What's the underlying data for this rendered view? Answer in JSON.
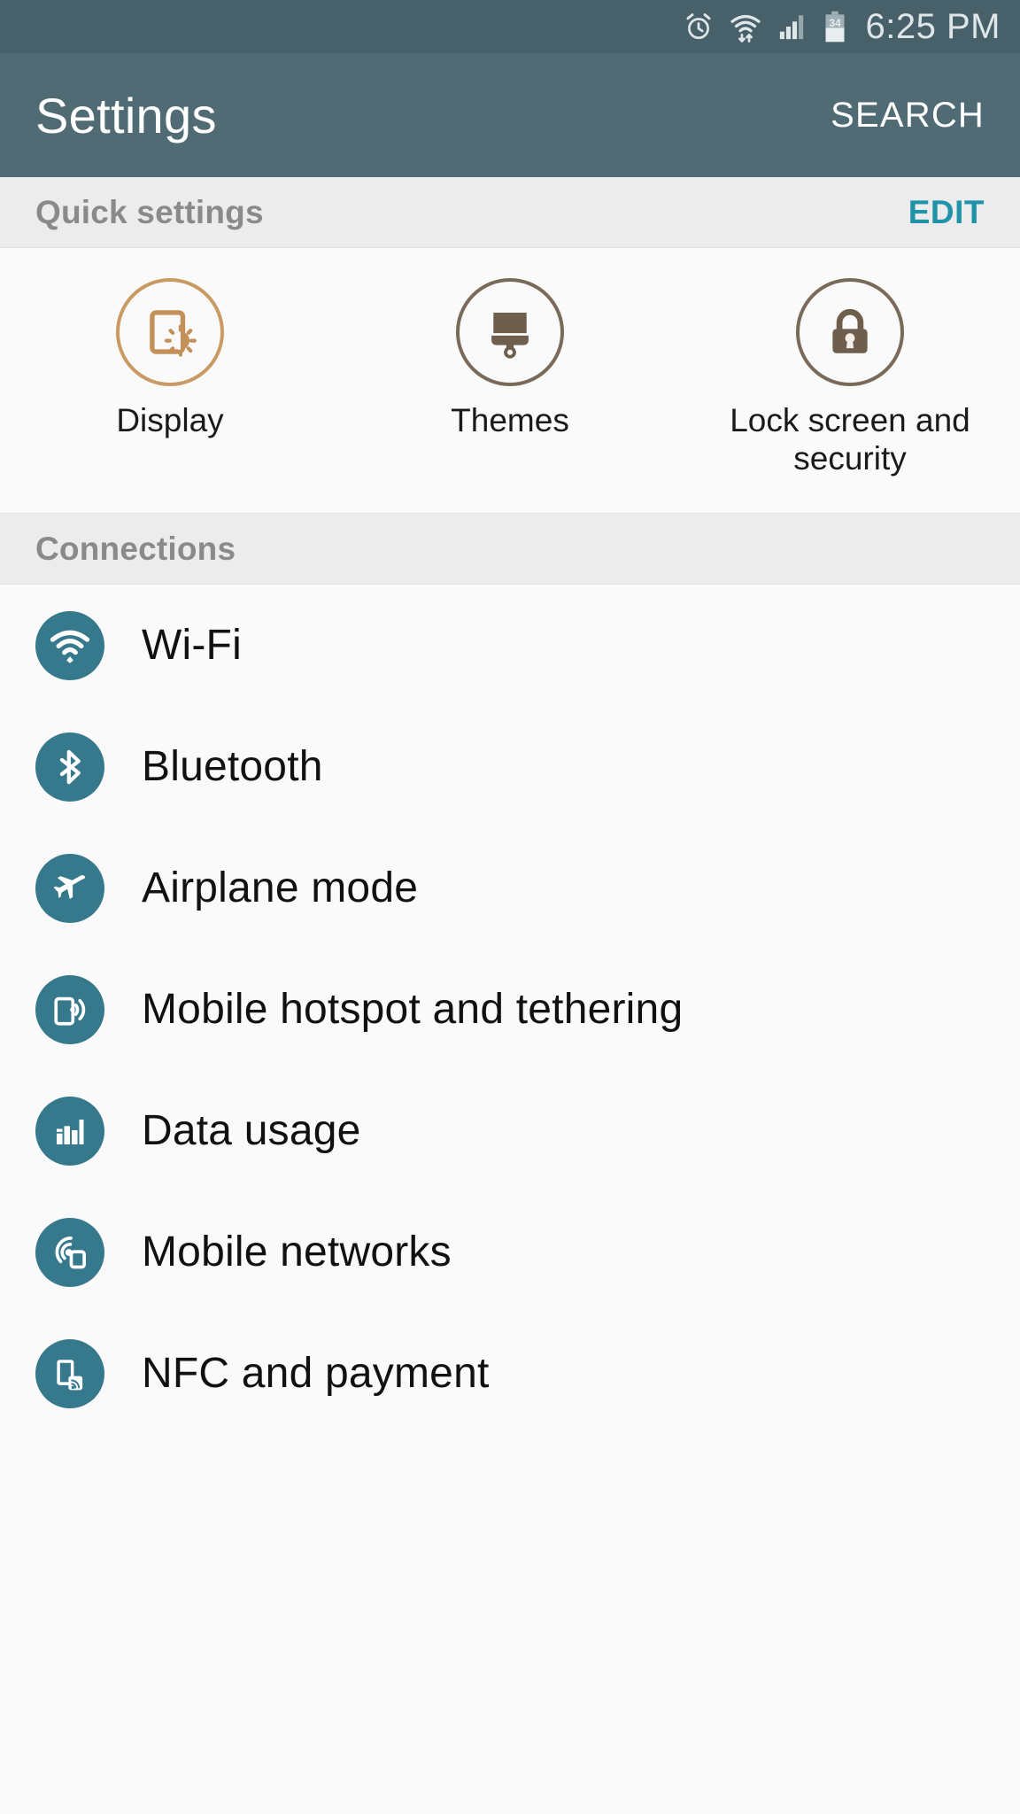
{
  "status_bar": {
    "icons": [
      "alarm-icon",
      "wifi-icon",
      "signal-icon",
      "battery-icon"
    ],
    "battery_level": "34",
    "time": "6:25 PM",
    "background_color": "#47606a",
    "text_color": "#dfe6e8"
  },
  "app_bar": {
    "title": "Settings",
    "search_label": "SEARCH",
    "background_color": "#516b74"
  },
  "quick_settings": {
    "header": "Quick settings",
    "edit_label": "EDIT",
    "edit_color": "#1f94a8",
    "accent_color": "#6e5e4e",
    "items": [
      {
        "label": "Display",
        "icon": "display-brightness-icon",
        "ring_color": "#c99a63",
        "glyph_color": "#c29058"
      },
      {
        "label": "Themes",
        "icon": "paintbrush-icon",
        "ring_color": "#7a6a59",
        "glyph_color": "#6e5e4e"
      },
      {
        "label": "Lock screen and security",
        "icon": "padlock-icon",
        "ring_color": "#7a6a59",
        "glyph_color": "#6e5e4e"
      }
    ]
  },
  "connections": {
    "header": "Connections",
    "icon_background": "#36798c",
    "items": [
      {
        "label": "Wi-Fi",
        "icon": "wifi-icon"
      },
      {
        "label": "Bluetooth",
        "icon": "bluetooth-icon"
      },
      {
        "label": "Airplane mode",
        "icon": "airplane-icon"
      },
      {
        "label": "Mobile hotspot and tethering",
        "icon": "hotspot-icon"
      },
      {
        "label": "Data usage",
        "icon": "data-usage-icon"
      },
      {
        "label": "Mobile networks",
        "icon": "mobile-networks-icon"
      },
      {
        "label": "NFC and payment",
        "icon": "nfc-icon"
      }
    ]
  }
}
